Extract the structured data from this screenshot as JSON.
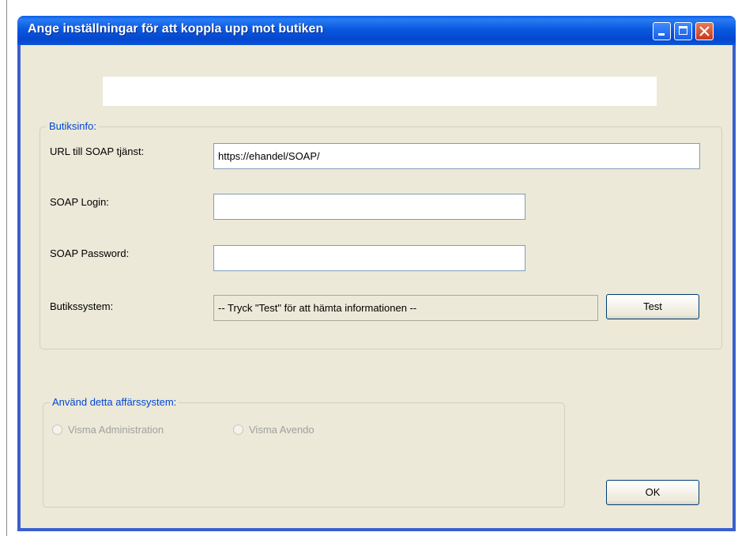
{
  "window": {
    "title": "Ange inställningar för att koppla upp mot butiken"
  },
  "butiksinfo": {
    "legend": "Butiksinfo:",
    "url_label": "URL till SOAP tjänst:",
    "url_value": "https://ehandel/SOAP/",
    "login_label": "SOAP Login:",
    "login_value": "",
    "password_label": "SOAP Password:",
    "password_value": "",
    "system_label": "Butikssystem:",
    "system_value": "-- Tryck \"Test\" för att hämta informationen --",
    "test_button": "Test"
  },
  "affarssystem": {
    "legend": "Använd detta affärssystem:",
    "options": [
      {
        "label": "Visma Administration",
        "selected": false,
        "enabled": false
      },
      {
        "label": "Visma Avendo",
        "selected": false,
        "enabled": false
      }
    ]
  },
  "ok_button": "OK",
  "colors": {
    "titlebar": "#0a5ee8",
    "client_bg": "#ece9d8",
    "legend_text": "#0046d5",
    "disabled_text": "#a0a0a0"
  }
}
